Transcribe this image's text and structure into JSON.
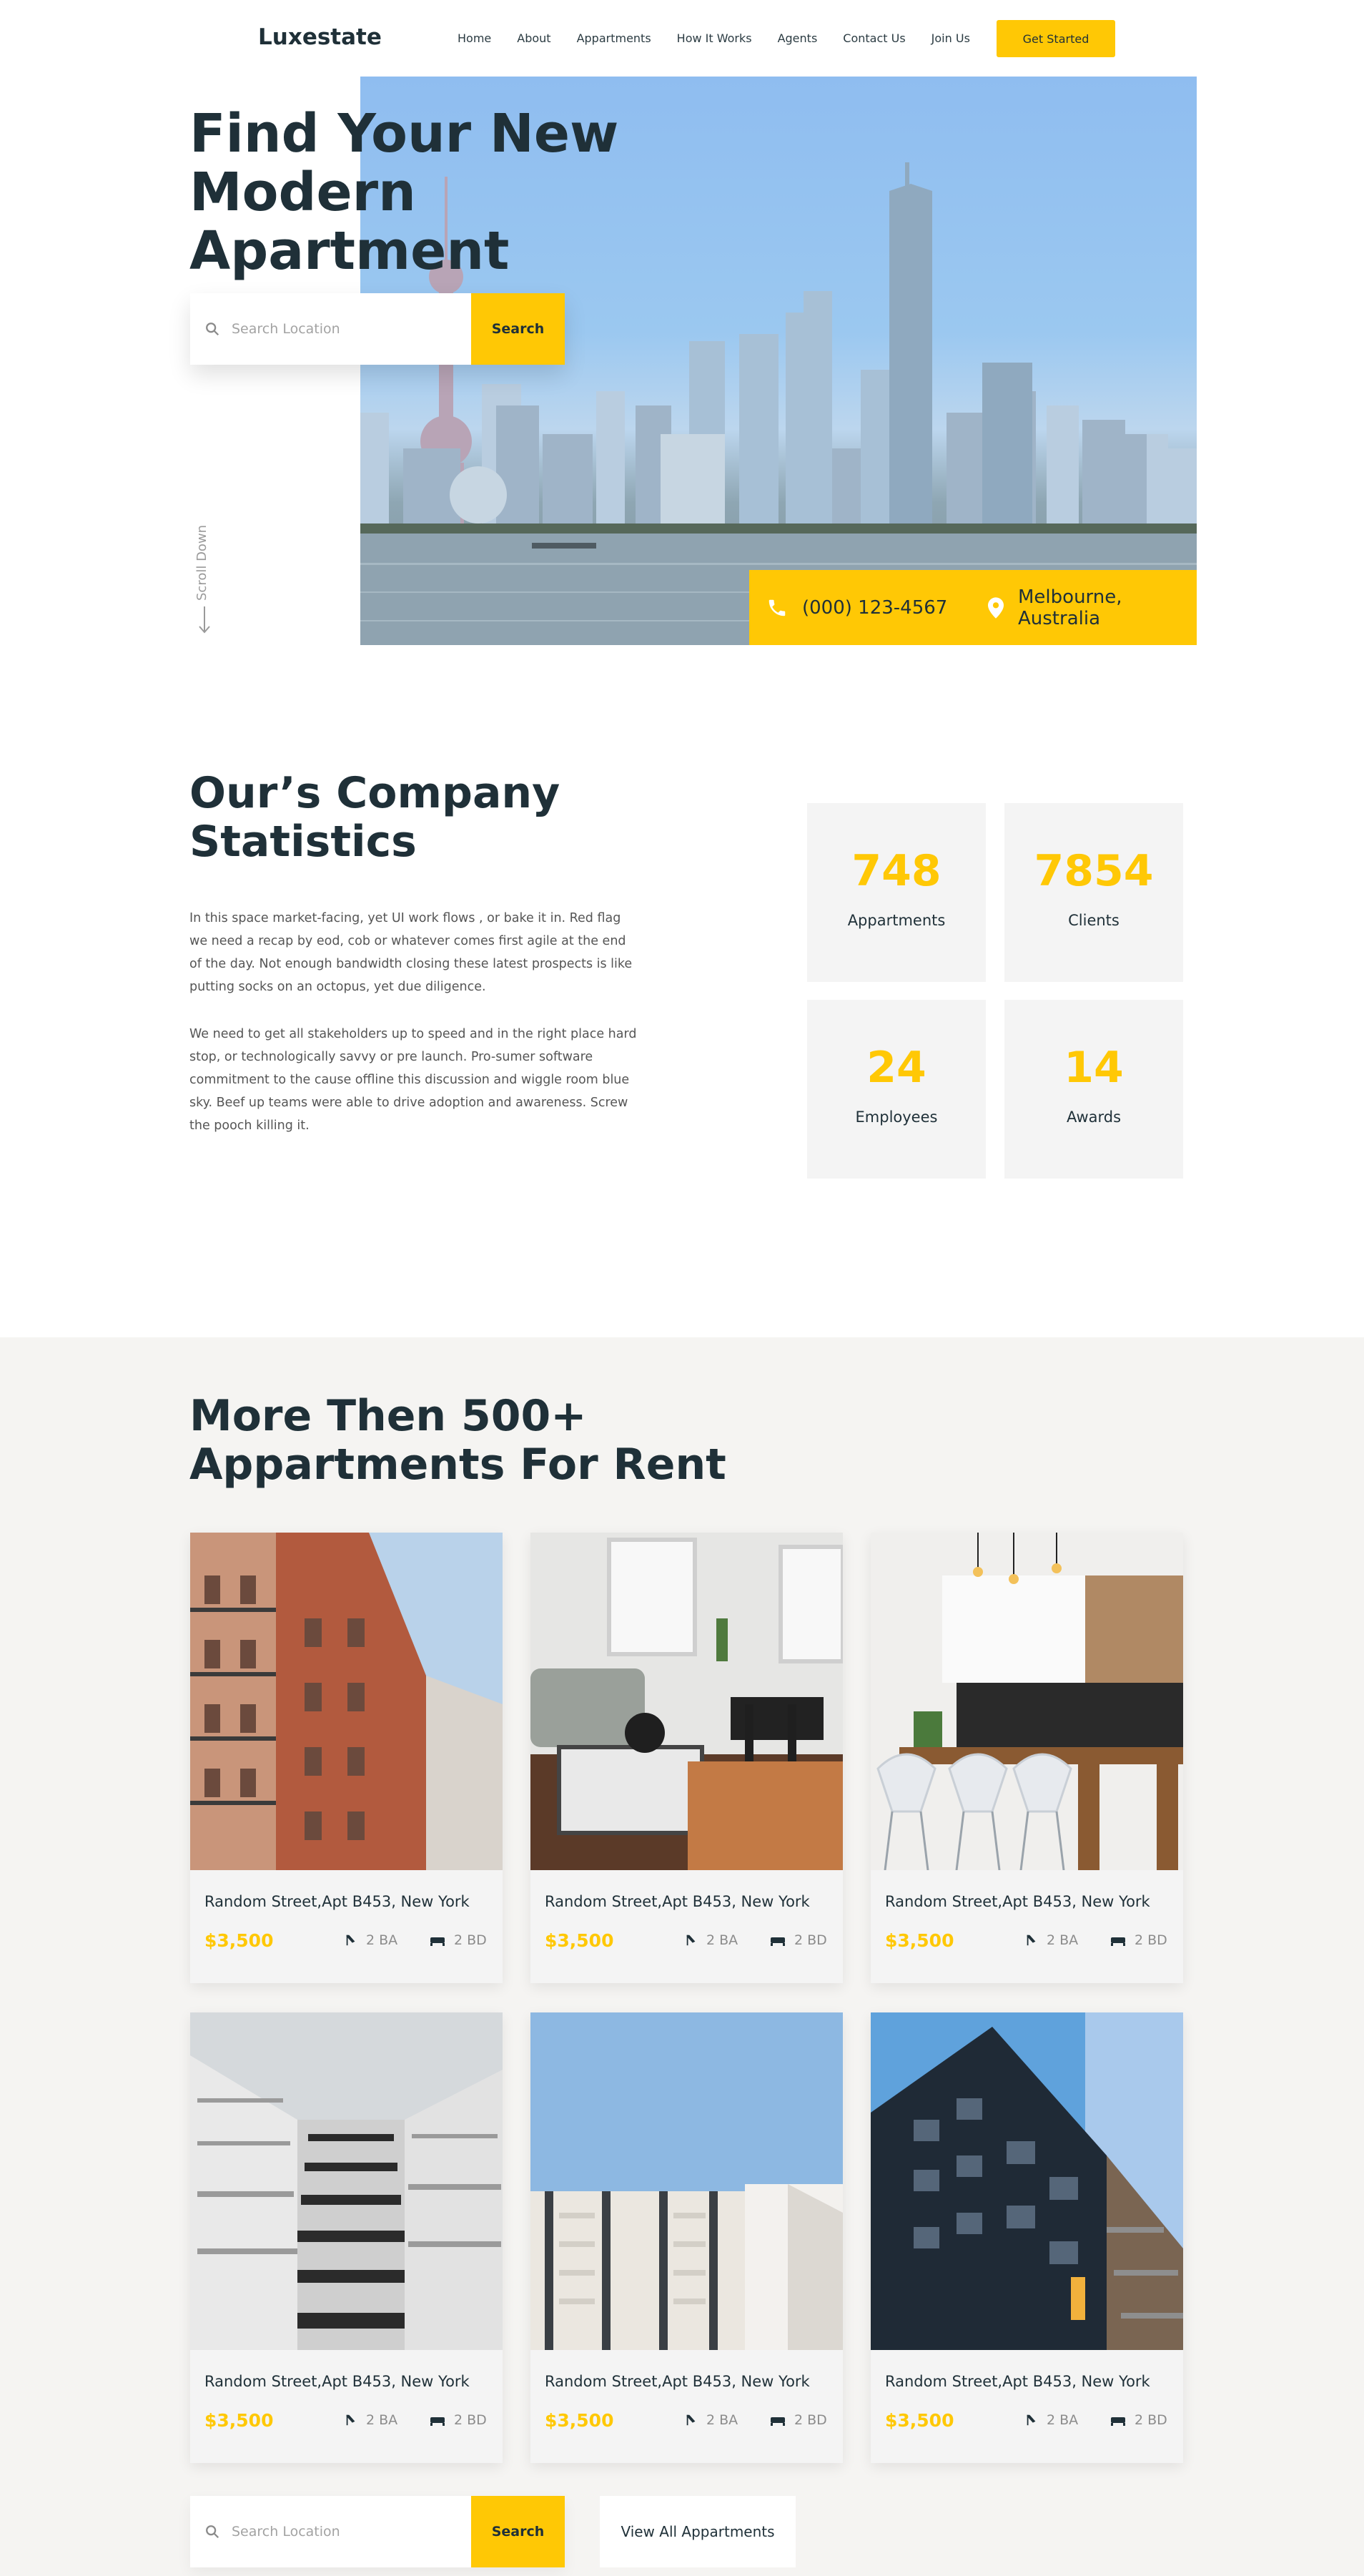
{
  "brand": {
    "logo": "Luxestate",
    "accent_color": "#ffc805",
    "text_color": "#1f3038"
  },
  "nav": {
    "links": [
      "Home",
      "About",
      "Appartments",
      "How It Works",
      "Agents",
      "Contact Us",
      "Join Us"
    ],
    "cta": "Get Started"
  },
  "hero": {
    "title_line1": "Find Your New",
    "title_line2": "Modern Apartment",
    "search_placeholder": "Search Location",
    "search_button": "Search",
    "scroll_label": "Scroll Down",
    "phone": "(000) 123-4567",
    "location": "Melbourne, Australia",
    "icons": [
      "search-icon",
      "phone-icon",
      "location-pin-icon",
      "arrow-down-icon"
    ]
  },
  "stats": {
    "title_line1": "Our’s Company",
    "title_line2": "Statistics",
    "paragraph1": "In this space market-facing, yet UI work flows , or bake it in. Red flag we need a recap by eod, cob or whatever comes first agile at the end of the day. Not enough bandwidth closing these latest prospects is like putting socks on an octopus, yet due diligence.",
    "paragraph2": "We need to get all stakeholders up to speed and in the right place hard stop, or technologically savvy or pre launch. Pro-sumer software commitment to the cause offline this discussion and wiggle room blue sky. Beef up teams were able to drive adoption and awareness. Screw the pooch killing it.",
    "items": [
      {
        "value": "748",
        "label": "Appartments"
      },
      {
        "value": "7854",
        "label": "Clients"
      },
      {
        "value": "24",
        "label": "Employees"
      },
      {
        "value": "14",
        "label": "Awards"
      }
    ]
  },
  "apartments": {
    "title_line1": "More Then 500+",
    "title_line2": "Appartments For Rent",
    "listings": [
      {
        "address": "Random Street,Apt B453, New York",
        "price": "$3,500",
        "baths": "2 BA",
        "beds": "2 BD",
        "image": "red-brick-building"
      },
      {
        "address": "Random Street,Apt B453, New York",
        "price": "$3,500",
        "baths": "2 BA",
        "beds": "2 BD",
        "image": "living-room"
      },
      {
        "address": "Random Street,Apt B453, New York",
        "price": "$3,500",
        "baths": "2 BA",
        "beds": "2 BD",
        "image": "kitchen"
      },
      {
        "address": "Random Street,Apt B453, New York",
        "price": "$3,500",
        "baths": "2 BA",
        "beds": "2 BD",
        "image": "tower-upward"
      },
      {
        "address": "Random Street,Apt B453, New York",
        "price": "$3,500",
        "baths": "2 BA",
        "beds": "2 BD",
        "image": "white-balconies"
      },
      {
        "address": "Random Street,Apt B453, New York",
        "price": "$3,500",
        "baths": "2 BA",
        "beds": "2 BD",
        "image": "dark-facade"
      }
    ],
    "search_placeholder": "Search Location",
    "search_button": "Search",
    "view_all": "View All Appartments"
  }
}
